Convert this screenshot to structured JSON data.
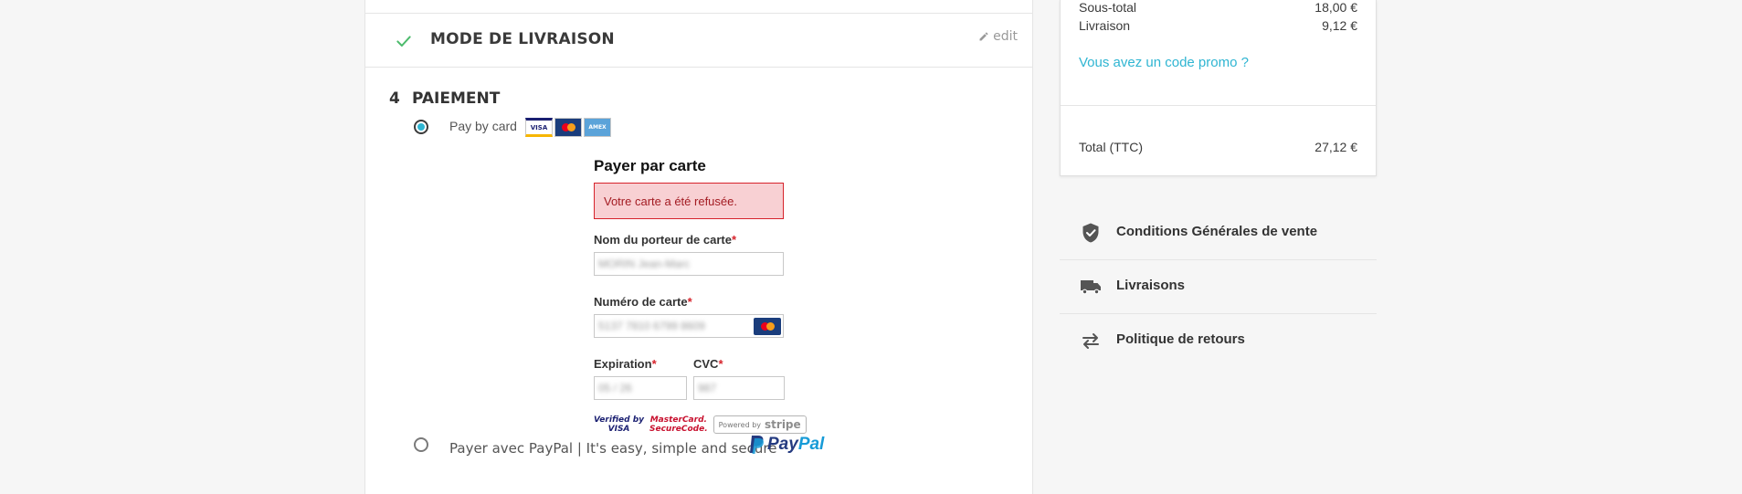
{
  "shipping_step": {
    "title": "Mode de livraison",
    "edit_label": "edit"
  },
  "payment_step": {
    "number": "4",
    "title": "PAIEMENT",
    "options": [
      {
        "label": "Pay by card",
        "selected": true
      },
      {
        "label": "Payer avec PayPal | It's easy, simple and secure",
        "selected": false
      }
    ],
    "card_brand_logos": [
      "VISA",
      "MasterCard",
      "American Express"
    ]
  },
  "card_form": {
    "title": "Payer par carte",
    "error_message": "Votre carte a été refusée.",
    "holder_label": "Nom du porteur de carte",
    "holder_value": "MORIN Jean-Marc",
    "number_label": "Numéro de carte",
    "number_value": "5137 7810 6799 8609",
    "expiry_label": "Expiration",
    "expiry_value": "05 / 26",
    "cvc_label": "CVC",
    "cvc_value": "987",
    "required_mark": "*"
  },
  "security_badges": {
    "visa_line1": "Verified by",
    "visa_line2": "VISA",
    "mc_line1": "MasterCard.",
    "mc_line2": "SecureCode.",
    "stripe_small": "Powered by",
    "stripe_brand": "stripe"
  },
  "paypal_logo": {
    "part1": "Pay",
    "part2": "Pal"
  },
  "summary": {
    "subtotal_label": "Sous-total",
    "subtotal_value": "18,00 €",
    "shipping_label": "Livraison",
    "shipping_value": "9,12 €",
    "promo_link": "Vous avez un code promo ?",
    "total_label": "Total (TTC)",
    "total_value": "27,12 €"
  },
  "reassurance": [
    {
      "label": "Conditions Générales de vente",
      "icon": "shield-check-icon"
    },
    {
      "label": "Livraisons",
      "icon": "truck-icon"
    },
    {
      "label": "Politique de retours",
      "icon": "swap-arrows-icon"
    }
  ],
  "colors": {
    "accent": "#2fb5d2",
    "check_green": "#4cbb6c",
    "error_bg": "#f8d0d3",
    "error_border": "#d6232b"
  }
}
